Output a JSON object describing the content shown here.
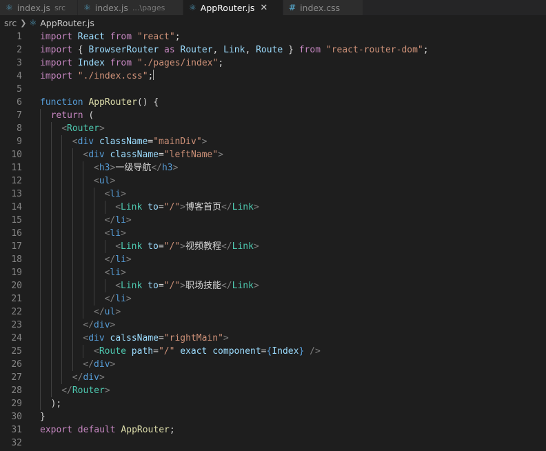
{
  "tabs": [
    {
      "name": "index.js",
      "desc": "src",
      "icon": "react-icon",
      "active": false
    },
    {
      "name": "index.js",
      "desc": "...\\pages",
      "icon": "react-icon",
      "active": false
    },
    {
      "name": "AppRouter.js",
      "desc": "",
      "icon": "react-icon",
      "active": true
    },
    {
      "name": "index.css",
      "desc": "",
      "icon": "hash-icon",
      "active": false
    }
  ],
  "breadcrumb": {
    "folder": "src",
    "file": "AppRouter.js"
  },
  "code_lines": [
    {
      "n": "1",
      "i": 0,
      "t": [
        [
          "kw",
          "import "
        ],
        [
          "var",
          "React"
        ],
        [
          "kw",
          " from "
        ],
        [
          "str",
          "\"react\""
        ],
        [
          "txt",
          ";"
        ]
      ]
    },
    {
      "n": "2",
      "i": 0,
      "t": [
        [
          "kw",
          "import "
        ],
        [
          "txt",
          "{ "
        ],
        [
          "var",
          "BrowserRouter"
        ],
        [
          "kw",
          " as "
        ],
        [
          "var",
          "Router"
        ],
        [
          "txt",
          ", "
        ],
        [
          "var",
          "Link"
        ],
        [
          "txt",
          ", "
        ],
        [
          "var",
          "Route"
        ],
        [
          "txt",
          " } "
        ],
        [
          "kw",
          "from "
        ],
        [
          "str",
          "\"react-router-dom\""
        ],
        [
          "txt",
          ";"
        ]
      ]
    },
    {
      "n": "3",
      "i": 0,
      "t": [
        [
          "kw",
          "import "
        ],
        [
          "var",
          "Index"
        ],
        [
          "kw",
          " from "
        ],
        [
          "str",
          "\"./pages/index\""
        ],
        [
          "txt",
          ";"
        ]
      ]
    },
    {
      "n": "4",
      "i": 0,
      "t": [
        [
          "kw",
          "import "
        ],
        [
          "str",
          "\"./index.css\""
        ],
        [
          "txt",
          ";"
        ]
      ],
      "cursor": true
    },
    {
      "n": "5",
      "i": 0,
      "t": []
    },
    {
      "n": "6",
      "i": 0,
      "t": [
        [
          "kb",
          "function "
        ],
        [
          "fn",
          "AppRouter"
        ],
        [
          "txt",
          "() {"
        ]
      ]
    },
    {
      "n": "7",
      "i": 1,
      "t": [
        [
          "kw",
          "return "
        ],
        [
          "txt",
          "("
        ]
      ]
    },
    {
      "n": "8",
      "i": 2,
      "t": [
        [
          "br",
          "<"
        ],
        [
          "cls",
          "Router"
        ],
        [
          "br",
          ">"
        ]
      ]
    },
    {
      "n": "9",
      "i": 3,
      "t": [
        [
          "br",
          "<"
        ],
        [
          "tag",
          "div "
        ],
        [
          "attr",
          "className"
        ],
        [
          "txt",
          "="
        ],
        [
          "str",
          "\"mainDiv\""
        ],
        [
          "br",
          ">"
        ]
      ]
    },
    {
      "n": "10",
      "i": 4,
      "t": [
        [
          "br",
          "<"
        ],
        [
          "tag",
          "div "
        ],
        [
          "attr",
          "className"
        ],
        [
          "txt",
          "="
        ],
        [
          "str",
          "\"leftName\""
        ],
        [
          "br",
          ">"
        ]
      ]
    },
    {
      "n": "11",
      "i": 5,
      "t": [
        [
          "br",
          "<"
        ],
        [
          "tag",
          "h3"
        ],
        [
          "br",
          ">"
        ],
        [
          "txt",
          "一级导航"
        ],
        [
          "br",
          "</"
        ],
        [
          "tag",
          "h3"
        ],
        [
          "br",
          ">"
        ]
      ]
    },
    {
      "n": "12",
      "i": 5,
      "t": [
        [
          "br",
          "<"
        ],
        [
          "tag",
          "ul"
        ],
        [
          "br",
          ">"
        ]
      ]
    },
    {
      "n": "13",
      "i": 6,
      "t": [
        [
          "br",
          "<"
        ],
        [
          "tag",
          "li"
        ],
        [
          "br",
          ">"
        ]
      ]
    },
    {
      "n": "14",
      "i": 7,
      "t": [
        [
          "br",
          "<"
        ],
        [
          "cls",
          "Link "
        ],
        [
          "attr",
          "to"
        ],
        [
          "txt",
          "="
        ],
        [
          "str",
          "\"/\""
        ],
        [
          "br",
          ">"
        ],
        [
          "txt",
          "博客首页"
        ],
        [
          "br",
          "</"
        ],
        [
          "cls",
          "Link"
        ],
        [
          "br",
          ">"
        ]
      ]
    },
    {
      "n": "15",
      "i": 6,
      "t": [
        [
          "br",
          "</"
        ],
        [
          "tag",
          "li"
        ],
        [
          "br",
          ">"
        ]
      ]
    },
    {
      "n": "16",
      "i": 6,
      "t": [
        [
          "br",
          "<"
        ],
        [
          "tag",
          "li"
        ],
        [
          "br",
          ">"
        ]
      ]
    },
    {
      "n": "17",
      "i": 7,
      "t": [
        [
          "br",
          "<"
        ],
        [
          "cls",
          "Link "
        ],
        [
          "attr",
          "to"
        ],
        [
          "txt",
          "="
        ],
        [
          "str",
          "\"/\""
        ],
        [
          "br",
          ">"
        ],
        [
          "txt",
          "视频教程"
        ],
        [
          "br",
          "</"
        ],
        [
          "cls",
          "Link"
        ],
        [
          "br",
          ">"
        ]
      ]
    },
    {
      "n": "18",
      "i": 6,
      "t": [
        [
          "br",
          "</"
        ],
        [
          "tag",
          "li"
        ],
        [
          "br",
          ">"
        ]
      ]
    },
    {
      "n": "19",
      "i": 6,
      "t": [
        [
          "br",
          "<"
        ],
        [
          "tag",
          "li"
        ],
        [
          "br",
          ">"
        ]
      ]
    },
    {
      "n": "20",
      "i": 7,
      "t": [
        [
          "br",
          "<"
        ],
        [
          "cls",
          "Link "
        ],
        [
          "attr",
          "to"
        ],
        [
          "txt",
          "="
        ],
        [
          "str",
          "\"/\""
        ],
        [
          "br",
          ">"
        ],
        [
          "txt",
          "职场技能"
        ],
        [
          "br",
          "</"
        ],
        [
          "cls",
          "Link"
        ],
        [
          "br",
          ">"
        ]
      ]
    },
    {
      "n": "21",
      "i": 6,
      "t": [
        [
          "br",
          "</"
        ],
        [
          "tag",
          "li"
        ],
        [
          "br",
          ">"
        ]
      ]
    },
    {
      "n": "22",
      "i": 5,
      "t": [
        [
          "br",
          "</"
        ],
        [
          "tag",
          "ul"
        ],
        [
          "br",
          ">"
        ]
      ]
    },
    {
      "n": "23",
      "i": 4,
      "t": [
        [
          "br",
          "</"
        ],
        [
          "tag",
          "div"
        ],
        [
          "br",
          ">"
        ]
      ]
    },
    {
      "n": "24",
      "i": 4,
      "t": [
        [
          "br",
          "<"
        ],
        [
          "tag",
          "div "
        ],
        [
          "attr",
          "calssName"
        ],
        [
          "txt",
          "="
        ],
        [
          "str",
          "\"rightMain\""
        ],
        [
          "br",
          ">"
        ]
      ]
    },
    {
      "n": "25",
      "i": 5,
      "t": [
        [
          "br",
          "<"
        ],
        [
          "cls",
          "Route "
        ],
        [
          "attr",
          "path"
        ],
        [
          "txt",
          "="
        ],
        [
          "str",
          "\"/\" "
        ],
        [
          "attr",
          "exact "
        ],
        [
          "attr",
          "component"
        ],
        [
          "txt",
          "="
        ],
        [
          "kb",
          "{"
        ],
        [
          "var",
          "Index"
        ],
        [
          "kb",
          "}"
        ],
        [
          "br",
          " />"
        ]
      ]
    },
    {
      "n": "26",
      "i": 4,
      "t": [
        [
          "br",
          "</"
        ],
        [
          "tag",
          "div"
        ],
        [
          "br",
          ">"
        ]
      ]
    },
    {
      "n": "27",
      "i": 3,
      "t": [
        [
          "br",
          "</"
        ],
        [
          "tag",
          "div"
        ],
        [
          "br",
          ">"
        ]
      ]
    },
    {
      "n": "28",
      "i": 2,
      "t": [
        [
          "br",
          "</"
        ],
        [
          "cls",
          "Router"
        ],
        [
          "br",
          ">"
        ]
      ]
    },
    {
      "n": "29",
      "i": 1,
      "t": [
        [
          "txt",
          ");"
        ]
      ]
    },
    {
      "n": "30",
      "i": 0,
      "t": [
        [
          "txt",
          "}"
        ]
      ]
    },
    {
      "n": "31",
      "i": 0,
      "t": [
        [
          "kw",
          "export "
        ],
        [
          "kw",
          "default "
        ],
        [
          "fn",
          "AppRouter"
        ],
        [
          "txt",
          ";"
        ]
      ]
    },
    {
      "n": "32",
      "i": 0,
      "t": []
    }
  ]
}
